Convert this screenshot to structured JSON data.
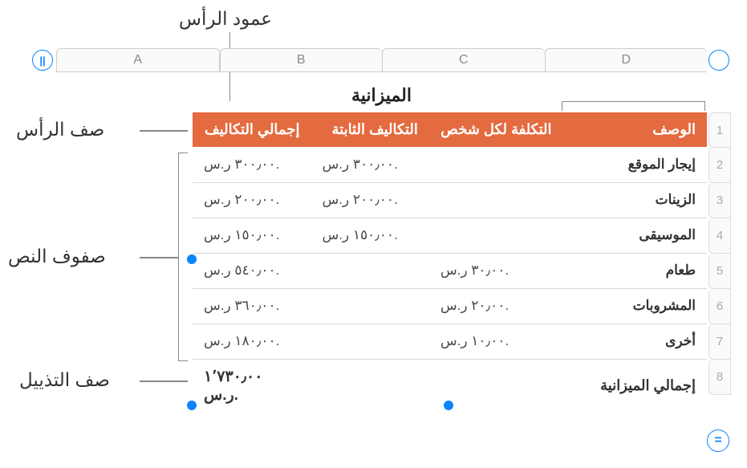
{
  "annotations": {
    "header_col": "عمود الرأس",
    "header_row": "صف الرأس",
    "body_rows": "صفوف النص",
    "footer_row": "صف التذييل"
  },
  "columns": [
    "A",
    "B",
    "C",
    "D"
  ],
  "rows": [
    "1",
    "2",
    "3",
    "4",
    "5",
    "6",
    "7",
    "8"
  ],
  "title": "الميزانية",
  "headers": {
    "desc": "الوصف",
    "per_person": "التكلفة لكل شخص",
    "fixed": "التكاليف الثابتة",
    "total": "إجمالي التكاليف"
  },
  "data": [
    {
      "desc": "إيجار الموقع",
      "per_person": "",
      "fixed": "٣٠٠٫٠٠ ر.س.",
      "total": "٣٠٠٫٠٠ ر.س."
    },
    {
      "desc": "الزينات",
      "per_person": "",
      "fixed": "٢٠٠٫٠٠ ر.س.",
      "total": "٢٠٠٫٠٠ ر.س."
    },
    {
      "desc": "الموسيقى",
      "per_person": "",
      "fixed": "١٥٠٫٠٠ ر.س.",
      "total": "١٥٠٫٠٠ ر.س."
    },
    {
      "desc": "طعام",
      "per_person": "٣٠٫٠٠ ر.س.",
      "fixed": "",
      "total": "٥٤٠٫٠٠ ر.س."
    },
    {
      "desc": "المشروبات",
      "per_person": "٢٠٫٠٠ ر.س.",
      "fixed": "",
      "total": "٣٦٠٫٠٠ ر.س."
    },
    {
      "desc": "أخرى",
      "per_person": "١٠٫٠٠ ر.س.",
      "fixed": "",
      "total": "١٨٠٫٠٠ ر.س."
    }
  ],
  "footer": {
    "desc": "إجمالي الميزانية",
    "per_person": "",
    "fixed": "",
    "total": "١٬٧٣٠٫٠٠ ر.س."
  },
  "icons": {
    "pause": "||",
    "eq": "="
  }
}
